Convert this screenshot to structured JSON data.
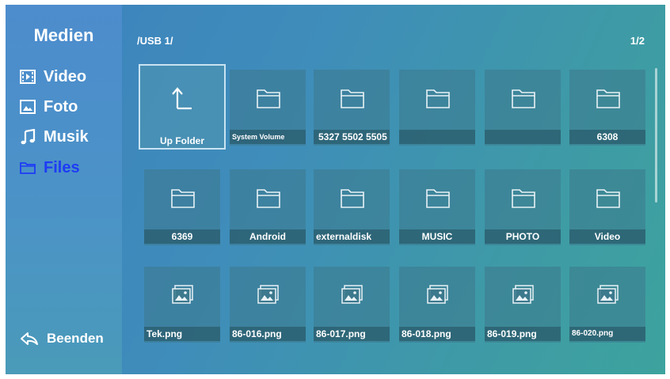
{
  "sidebar": {
    "title": "Medien",
    "items": [
      {
        "label": "Video",
        "icon": "video-icon",
        "active": false
      },
      {
        "label": "Foto",
        "icon": "photo-icon",
        "active": false
      },
      {
        "label": "Musik",
        "icon": "music-icon",
        "active": false
      },
      {
        "label": "Files",
        "icon": "folder-icon",
        "active": true
      }
    ],
    "exit_label": "Beenden",
    "exit_icon": "back-arrow-icon"
  },
  "header": {
    "path": "/USB 1/",
    "page": "1/2"
  },
  "grid": {
    "rows": [
      [
        {
          "label": "Up Folder",
          "type": "up",
          "icon": "up-arrow-icon",
          "selected": true
        },
        {
          "label": "System Volume",
          "type": "folder",
          "icon": "folder-icon"
        },
        {
          "label": "5327 5502 5505",
          "type": "folder",
          "icon": "folder-icon"
        },
        {
          "label": "",
          "type": "folder",
          "icon": "folder-icon"
        },
        {
          "label": "",
          "type": "folder",
          "icon": "folder-icon"
        },
        {
          "label": "6308",
          "type": "folder",
          "icon": "folder-icon"
        }
      ],
      [
        {
          "label": "6369",
          "type": "folder",
          "icon": "folder-icon"
        },
        {
          "label": "Android",
          "type": "folder",
          "icon": "folder-icon"
        },
        {
          "label": "externaldisk",
          "type": "folder",
          "icon": "folder-icon"
        },
        {
          "label": "MUSIC",
          "type": "folder",
          "icon": "folder-icon"
        },
        {
          "label": "PHOTO",
          "type": "folder",
          "icon": "folder-icon"
        },
        {
          "label": "Video",
          "type": "folder",
          "icon": "folder-icon"
        }
      ],
      [
        {
          "label": "Tek.png",
          "type": "image",
          "icon": "image-file-icon"
        },
        {
          "label": "86-016.png",
          "type": "image",
          "icon": "image-file-icon"
        },
        {
          "label": "86-017.png",
          "type": "image",
          "icon": "image-file-icon"
        },
        {
          "label": "86-018.png",
          "type": "image",
          "icon": "image-file-icon"
        },
        {
          "label": "86-019.png",
          "type": "image",
          "icon": "image-file-icon"
        },
        {
          "label": "86-020.png",
          "type": "image",
          "icon": "image-file-icon"
        }
      ]
    ]
  },
  "colors": {
    "active_menu": "#1e3cf5",
    "text": "#ffffff",
    "background": "#3f8dba"
  }
}
